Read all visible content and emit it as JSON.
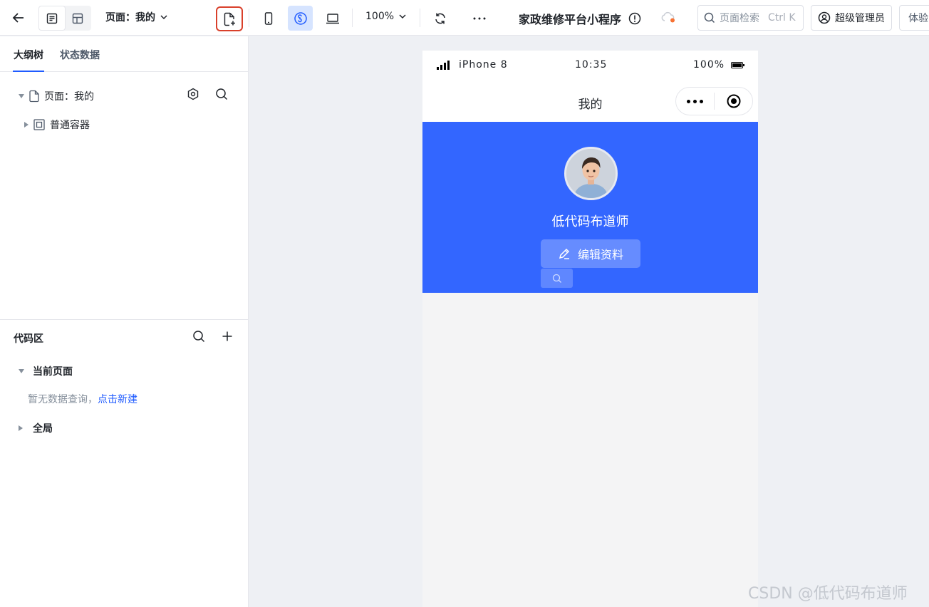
{
  "toolbar": {
    "page_select": "页面：我的",
    "zoom": "100%",
    "app_title": "家政维修平台小程序",
    "search_placeholder": "页面检索",
    "search_shortcut": "Ctrl K",
    "user_role": "超级管理员",
    "experience_label": "体验",
    "accent_color": "#1f5bff",
    "highlight_color": "#d9402b"
  },
  "left_panel": {
    "tabs": [
      {
        "label": "大纲树",
        "active": true
      },
      {
        "label": "状态数据",
        "active": false
      }
    ],
    "outline": [
      {
        "label": "页面：我的",
        "icon": "page-icon",
        "expanded": true
      },
      {
        "label": "普通容器",
        "icon": "container-icon",
        "expanded": false
      }
    ],
    "code_area": {
      "title": "代码区",
      "groups": [
        {
          "label": "当前页面",
          "expanded": true
        },
        {
          "label": "全局",
          "expanded": false
        }
      ],
      "empty_text": "暂无数据查询，",
      "create_link": "点击新建"
    }
  },
  "phone": {
    "carrier": "iPhone 8",
    "time": "10:35",
    "battery": "100%",
    "nav_title": "我的",
    "username": "低代码布道师",
    "edit_button": "编辑资料",
    "hero_color": "#3366ff"
  },
  "watermark": "CSDN @低代码布道师"
}
